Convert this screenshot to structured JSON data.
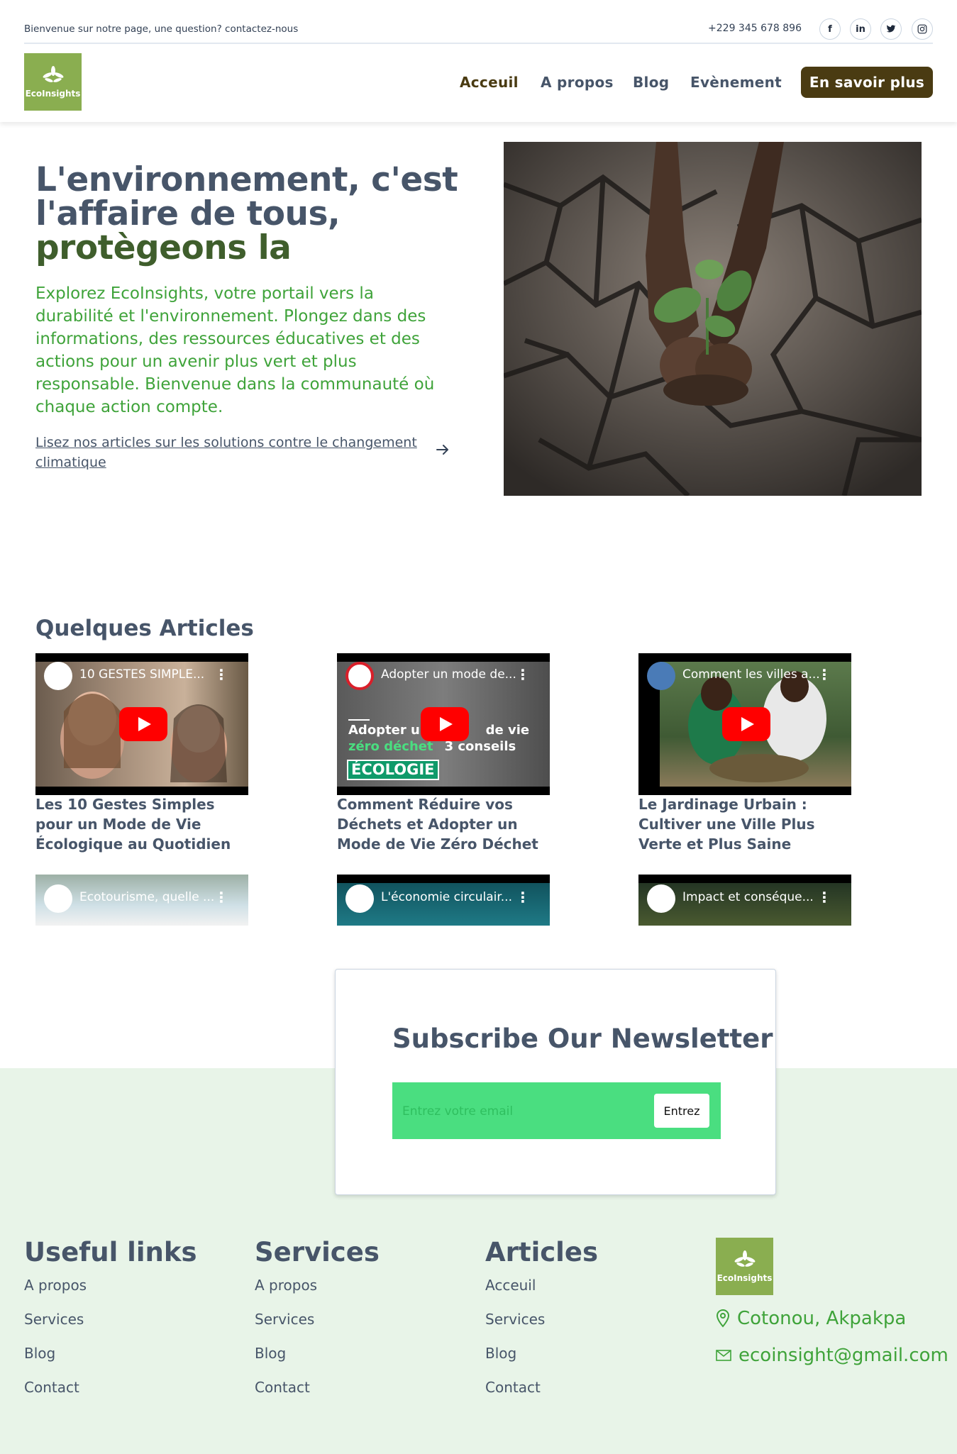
{
  "topbar": {
    "welcome": "Bienvenue sur notre page, une question? contactez-nous",
    "phone": "+229 345 678 896",
    "socials": [
      "f",
      "in",
      "t",
      "ig"
    ]
  },
  "brand": {
    "name": "EcoInsights",
    "color": "#8aae50"
  },
  "nav": {
    "items": [
      "Acceuil",
      "A propos",
      "Blog",
      "Evènement"
    ],
    "cta": "En savoir plus"
  },
  "hero": {
    "title_line1": "L'environnement, c'est",
    "title_line2": "l'affaire de tous,",
    "title_accent": "protègeons la",
    "description": "Explorez EcoInsights, votre portail vers la durabilité et l'environnement. Plongez dans des informations, des ressources éducatives et des actions pour un avenir plus vert et plus responsable. Bienvenue dans la communauté où chaque action compte.",
    "link": "Lisez nos articles sur les solutions contre le changement climatique"
  },
  "articles": {
    "title": "Quelques Articles",
    "items": [
      {
        "video_title": "10 GESTES SIMPLE...",
        "caption": "Les 10 Gestes Simples pour un Mode de Vie Écologique au Quotidien"
      },
      {
        "video_title": "Adopter un mode de...",
        "caption": "Comment Réduire vos Déchets et Adopter un Mode de Vie Zéro Déchet"
      },
      {
        "video_title": "Comment les villes a...",
        "caption": "Le Jardinage Urbain : Cultiver une Ville Plus Verte et Plus Saine"
      },
      {
        "video_title": "Ecotourisme, quelle ...",
        "caption": ""
      },
      {
        "video_title": "L'économie circulair...",
        "caption": ""
      },
      {
        "video_title": "Impact et conséque...",
        "caption": ""
      }
    ],
    "overlay": {
      "line1": "Adopter un",
      "line2": "de vie",
      "line3": "zéro déchet",
      "line4": "3 conseils",
      "badge": "ÉCOLOGIE"
    }
  },
  "newsletter": {
    "title": "Subscribe Our Newsletter",
    "placeholder": "Entrez votre email",
    "button": "Entrez"
  },
  "footer": {
    "columns": [
      {
        "title": "Useful links",
        "links": [
          "A propos",
          "Services",
          "Blog",
          "Contact"
        ]
      },
      {
        "title": "Services",
        "links": [
          "A propos",
          "Services",
          "Blog",
          "Contact"
        ]
      },
      {
        "title": "Articles",
        "links": [
          "Acceuil",
          "Services",
          "Blog",
          "Contact"
        ]
      }
    ],
    "location": "Cotonou, Akpakpa",
    "email": "ecoinsight@gmail.com"
  }
}
